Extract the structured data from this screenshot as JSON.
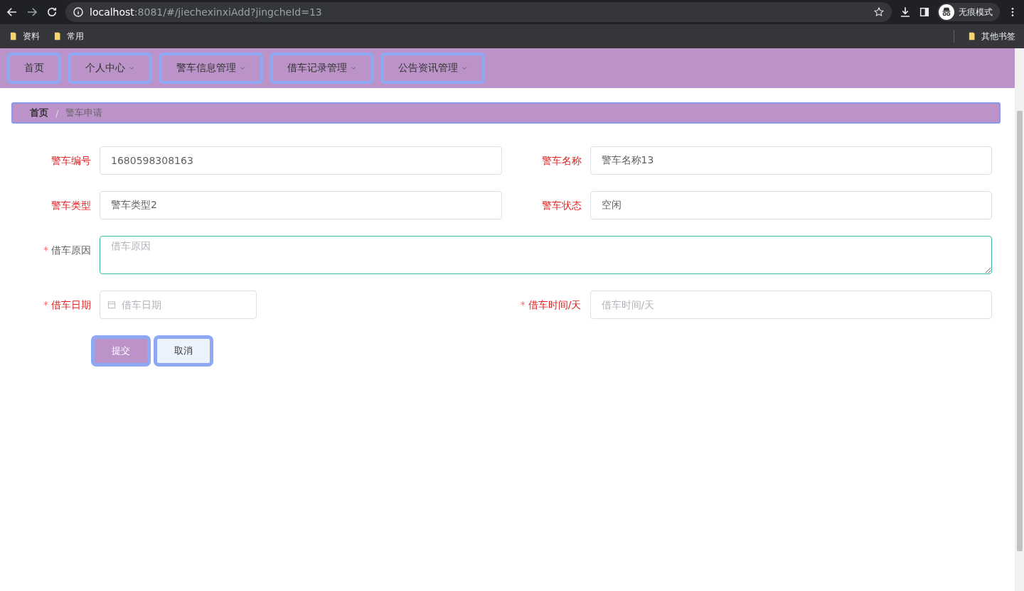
{
  "browser": {
    "url_host": "localhost",
    "url_rest": ":8081/#/jiechexinxiAdd?jingcheId=13",
    "profile": "无痕模式",
    "bookmarks": [
      "资料",
      "常用"
    ],
    "other_bookmarks": "其他书签"
  },
  "nav": {
    "items": [
      {
        "label": "首页",
        "dropdown": false
      },
      {
        "label": "个人中心",
        "dropdown": true
      },
      {
        "label": "警车信息管理",
        "dropdown": true
      },
      {
        "label": "借车记录管理",
        "dropdown": true
      },
      {
        "label": "公告资讯管理",
        "dropdown": true
      }
    ]
  },
  "breadcrumb": {
    "separator": "/",
    "items": [
      "首页",
      "警车申请"
    ]
  },
  "form": {
    "rows": [
      {
        "fields": [
          {
            "kind": "text",
            "label": "警车编号",
            "highlighted": true,
            "value": "1680598308163"
          },
          {
            "kind": "text",
            "label": "警车名称",
            "highlighted": true,
            "value": "警车名称13"
          }
        ]
      },
      {
        "fields": [
          {
            "kind": "text",
            "label": "警车类型",
            "highlighted": true,
            "value": "警车类型2"
          },
          {
            "kind": "text",
            "label": "警车状态",
            "highlighted": true,
            "value": "空闲"
          }
        ]
      },
      {
        "fields": [
          {
            "kind": "textarea",
            "label": "借车原因",
            "required_mark": "*",
            "highlighted": false,
            "focused": true,
            "placeholder": "借车原因"
          }
        ]
      },
      {
        "fields": [
          {
            "kind": "date",
            "label": "借车日期",
            "required_mark": "*",
            "highlighted": true,
            "placeholder": "借车日期"
          },
          {
            "kind": "text",
            "label": "借车时间/天",
            "required_mark": "*",
            "highlighted": true,
            "placeholder": "借车时间/天"
          }
        ]
      }
    ],
    "buttons": [
      {
        "kind": "primary",
        "label": "提交"
      },
      {
        "kind": "secondary",
        "label": "取消"
      }
    ]
  }
}
